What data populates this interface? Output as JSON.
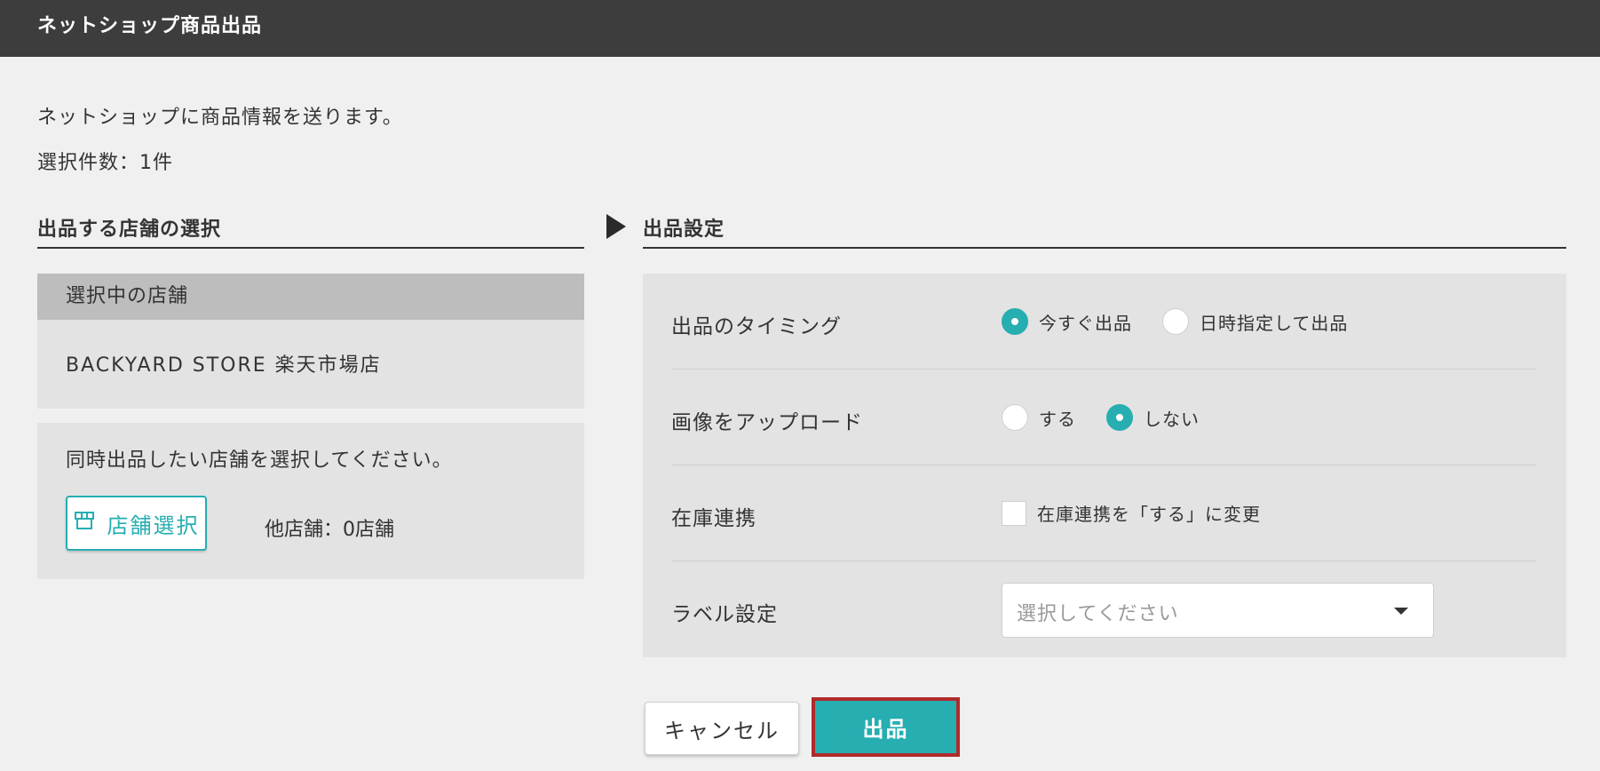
{
  "window": {
    "title": "ネットショップ商品出品"
  },
  "intro": {
    "message": "ネットショップに商品情報を送ります。",
    "selected_count": "選択件数：1件"
  },
  "store_section": {
    "heading": "出品する店舗の選択",
    "current_header": "選択中の店舗",
    "current_store": "BACKYARD STORE 楽天市場店",
    "multi_prompt": "同時出品したい店舗を選択してください。",
    "select_button_label": "店舗選択",
    "select_button_icon": "store-icon",
    "other_stores": "他店舗：0店舗"
  },
  "settings": {
    "heading": "出品設定",
    "timing": {
      "label": "出品のタイミング",
      "options": [
        {
          "label": "今すぐ出品",
          "selected": true
        },
        {
          "label": "日時指定して出品",
          "selected": false
        }
      ]
    },
    "upload_images": {
      "label": "画像をアップロード",
      "options": [
        {
          "label": "する",
          "selected": false
        },
        {
          "label": "しない",
          "selected": true
        }
      ]
    },
    "inventory": {
      "label": "在庫連携",
      "checkbox_label": "在庫連携を「する」に変更",
      "checked": false
    },
    "label_setting": {
      "label": "ラベル設定",
      "placeholder": "選択してください"
    }
  },
  "footer": {
    "cancel_label": "キャンセル",
    "submit_label": "出品"
  },
  "colors": {
    "accent": "#26aeb1",
    "titlebar": "#3d3d3d",
    "highlight": "#b12a2a"
  }
}
